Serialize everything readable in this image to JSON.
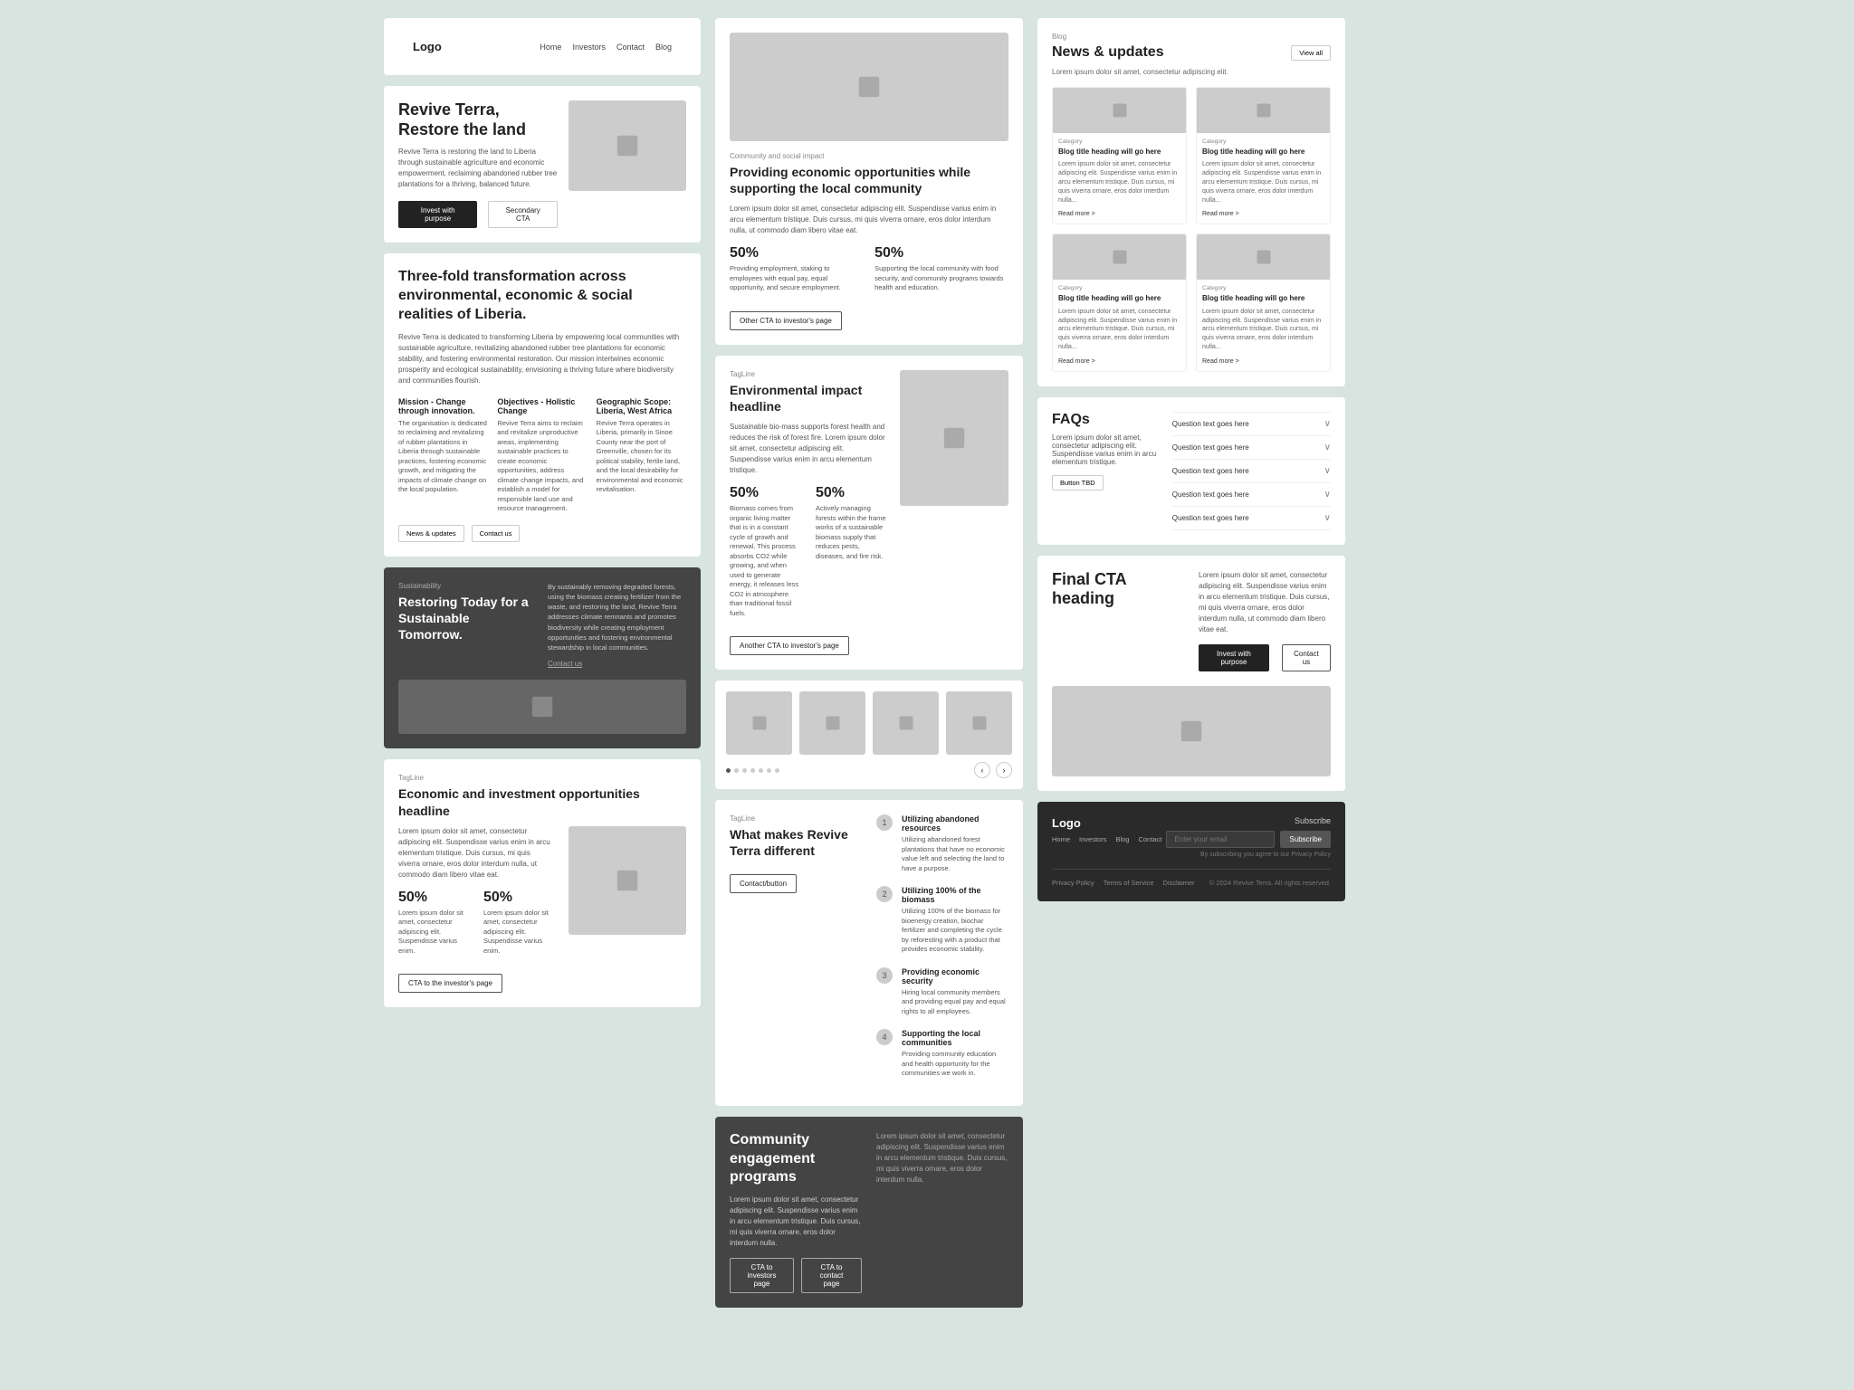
{
  "col1": {
    "navbar": {
      "logo": "Logo",
      "links": [
        "Home",
        "Investors",
        "Contact",
        "Blog"
      ]
    },
    "hero": {
      "title": "Revive Terra, Restore the land",
      "desc": "Revive Terra is restoring the land to Liberia through sustainable agriculture and economic empowerment, reclaiming abandoned rubber tree plantations for a thriving, balanced future.",
      "btn_primary": "Invest with purpose",
      "btn_secondary": "Secondary CTA"
    },
    "transform": {
      "title": "Three-fold transformation across environmental, economic & social realities of Liberia.",
      "desc": "Revive Terra is dedicated to transforming Liberia by empowering local communities with sustainable agriculture, revitalizing abandoned rubber tree plantations for economic stability, and fostering environmental restoration. Our mission intertwines economic prosperity and ecological sustainability, envisioning a thriving future where biodiversity and communities flourish.",
      "col1_title": "Mission - Change through innovation.",
      "col1_desc": "The organisation is dedicated to reclaiming and revitalizing of rubber plantations in Liberia through sustainable practices, fostering economic growth, and mitigating the impacts of climate change on the local population.",
      "col2_title": "Objectives - Holistic Change",
      "col2_desc": "Revive Terra aims to reclaim and revitalize unproductive areas, implementing sustainable practices to create economic opportunities, address climate change impacts, and establish a model for responsible land use and resource management.",
      "col3_title": "Geographic Scope: Liberia, West Africa",
      "col3_desc": "Revive Terra operates in Liberia, primarily in Sinoe County near the port of Greenville, chosen for its political stability, fertile land, and the local desirability for environmental and economic revitalisation.",
      "btn1": "News & updates",
      "btn2": "Contact us"
    },
    "sustainability": {
      "tagline": "Sustainability",
      "title": "Restoring Today for a Sustainable Tomorrow.",
      "desc": "By sustainably removing degraded forests, using the biomass creating fertilizer from the waste, and restoring the land, Revive Terra addresses climate remnants and promotes biodiversity while creating employment opportunities and fostering environmental stewardship in local communities.",
      "cta": "Contact us"
    },
    "economic": {
      "tagline": "TagLine",
      "heading": "Economic and investment opportunities headline",
      "desc": "Lorem ipsum dolor sit amet, consectetur adipiscing elit. Suspendisse varius enim in arcu elementum tristique. Duis cursus, mi quis viverra ornare, eros dolor interdum nulla, ut commodo diam libero vitae eat.",
      "stat1_number": "50%",
      "stat1_desc": "Lorem ipsum dolor sit amet, consectetur adipiscing elit. Suspendisse varius enim.",
      "stat2_number": "50%",
      "stat2_desc": "Lorem ipsum dolor sit amet, consectetur adipiscing elit. Suspendisse varius enim.",
      "cta": "CTA to the investor's page"
    }
  },
  "col2": {
    "providing": {
      "tagline": "Community and social impact",
      "heading": "Providing economic opportunities while supporting the local community",
      "desc": "Lorem ipsum dolor sit amet, consectetur adipiscing elit. Suspendisse varius enim in arcu elementum tristique. Duis cursus, mi quis viverra ornare, eros dolor interdum nulla, ut commodo diam libero vitae eat.",
      "stat1_number": "50%",
      "stat1_desc": "Providing employment, staking to employees with equal pay, equal opportunity, and secure employment.",
      "stat2_number": "50%",
      "stat2_desc": "Supporting the local community with food security, and community programs towards health and education.",
      "cta": "Other CTA to investor's page"
    },
    "environmental": {
      "tagline": "TagLine",
      "heading": "Environmental impact headline",
      "desc": "Sustainable bio-mass supports forest health and reduces the risk of forest fire. Lorem ipsum dolor sit amet, consectetur adipiscing elit. Suspendisse varius enim in arcu elementum tristique.",
      "stat1_number": "50%",
      "stat1_desc": "Biomass comes from organic living matter that is in a constant cycle of growth and renewal. This process absorbs CO2 while growing, and when used to generate energy, it releases less CO2 in atmosphere than traditional fossil fuels.",
      "stat2_number": "50%",
      "stat2_desc": "Actively managing forests within the frame works of a sustainable biomass supply that reduces pests, diseases, and fire risk.",
      "cta": "Another CTA to investor's page"
    },
    "carousel": {
      "images": [
        "img1",
        "img2",
        "img3",
        "img4"
      ],
      "dots": [
        true,
        false,
        false,
        false,
        false,
        false,
        false
      ],
      "active_dot": 0
    },
    "different": {
      "tagline": "TagLine",
      "heading": "What makes Revive Terra different",
      "contact_btn": "Contact/button",
      "items": [
        {
          "icon": "1",
          "title": "Utilizing abandoned resources",
          "desc": "Utilizing abandoned forest plantations that have no economic value left and selecting the land to have a purpose."
        },
        {
          "icon": "2",
          "title": "Utilizing 100% of the biomass",
          "desc": "Utilizing 100% of the biomass for bioenergy creation, biochar fertilizer and completing the cycle by reforesting with a product that provides economic stability."
        },
        {
          "icon": "3",
          "title": "Providing economic security",
          "desc": "Hiring local community members and providing equal pay and equal rights to all employees."
        },
        {
          "icon": "4",
          "title": "Supporting the local communities",
          "desc": "Providing community education and health opportunity for the communities we work in."
        }
      ]
    },
    "community": {
      "heading": "Community engagement programs",
      "desc": "Lorem ipsum dolor sit amet, consectetur adipiscing elit. Suspendisse varius enim in arcu elementum tristique. Duis cursus, mi quis viverra ornare, eros dolor interdum nulla.",
      "cta1": "CTA to investors page",
      "cta2": "CTA to contact page"
    }
  },
  "col3": {
    "blog": {
      "tagline": "Blog",
      "title": "News & updates",
      "desc": "Lorem ipsum dolor sit amet, consectetur adipiscing elit.",
      "view_all": "View all",
      "cards": [
        {
          "category": "Category",
          "title": "Blog title heading will go here",
          "desc": "Lorem ipsum dolor sit amet, consectetur adipiscing elit. Suspendisse varius enim in arcu elementum tristique. Duis cursus, mi quis viverra ornare, eros dolor interdum nulla...",
          "read_more": "Read more >"
        },
        {
          "category": "Category",
          "title": "Blog title heading will go here",
          "desc": "Lorem ipsum dolor sit amet, consectetur adipiscing elit. Suspendisse varius enim in arcu elementum tristique. Duis cursus, mi quis viverra ornare, eros dolor interdum nulla...",
          "read_more": "Read more >"
        },
        {
          "category": "Category",
          "title": "Blog title heading will go here",
          "desc": "Lorem ipsum dolor sit amet, consectetur adipiscing elit. Suspendisse varius enim in arcu elementum tristique. Duis cursus, mi quis viverra ornare, eros dolor interdum nulla...",
          "read_more": "Read more >"
        },
        {
          "category": "Category",
          "title": "Blog title heading will go here",
          "desc": "Lorem ipsum dolor sit amet, consectetur adipiscing elit. Suspendisse varius enim in arcu elementum tristique. Duis cursus, mi quis viverra ornare, eros dolor interdum nulla...",
          "read_more": "Read more >"
        }
      ]
    },
    "faq": {
      "title": "FAQs",
      "desc": "Lorem ipsum dolor sit amet, consectetur adipiscing elit. Suspendisse varius enim in arcu elementum tristique.",
      "btn": "Button TBD",
      "items": [
        "Question text goes here",
        "Question text goes here",
        "Question text goes here",
        "Question text goes here",
        "Question text goes here"
      ]
    },
    "final_cta": {
      "title": "Final CTA heading",
      "desc": "Lorem ipsum dolor sit amet, consectetur adipiscing elit. Suspendisse varius enim in arcu elementum tristique. Duis cursus, mi quis viverra ornare, eros dolor interdum nulla, ut commodo diam libero vitae eat.",
      "btn_primary": "Invest with purpose",
      "btn_secondary": "Contact us"
    },
    "footer": {
      "logo": "Logo",
      "links": [
        "Home",
        "Investors",
        "Blog",
        "Contact"
      ],
      "subscribe_label": "Subscribe",
      "input_placeholder": "Enter your email",
      "subscribe_btn": "Subscribe",
      "privacy_text": "By subscribing you agree to our Privacy Policy",
      "legal": [
        "Privacy Policy",
        "Terms of Service",
        "Disclaimer"
      ],
      "copyright": "© 2024 Revive Terra. All rights reserved."
    }
  }
}
